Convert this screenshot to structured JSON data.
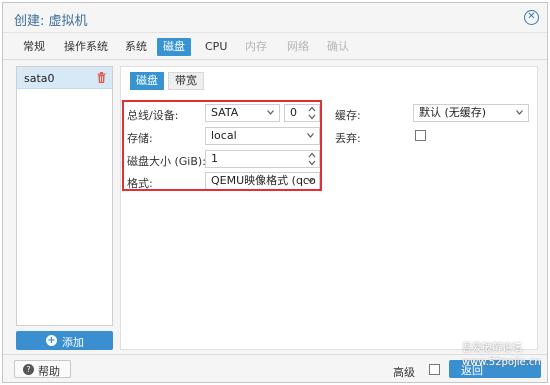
{
  "window": {
    "title": "创建: 虚拟机",
    "close_icon": "circle-x-icon"
  },
  "tabs": [
    {
      "label": "常规",
      "state": "normal"
    },
    {
      "label": "操作系统",
      "state": "normal"
    },
    {
      "label": "系统",
      "state": "normal"
    },
    {
      "label": "磁盘",
      "state": "active"
    },
    {
      "label": "CPU",
      "state": "normal"
    },
    {
      "label": "内存",
      "state": "disabled"
    },
    {
      "label": "网络",
      "state": "disabled"
    },
    {
      "label": "确认",
      "state": "disabled"
    }
  ],
  "disk_list": {
    "items": [
      {
        "label": "sata0"
      }
    ],
    "delete_icon": "trash-icon"
  },
  "add_button": {
    "label": "添加",
    "icon": "plus-circle-icon"
  },
  "subtabs": [
    {
      "label": "磁盘",
      "state": "active"
    },
    {
      "label": "带宽",
      "state": "normal"
    }
  ],
  "form": {
    "bus_device": {
      "label": "总线/设备:",
      "bus_value": "SATA",
      "device_value": "0"
    },
    "storage": {
      "label": "存储:",
      "value": "local"
    },
    "disk_size": {
      "label": "磁盘大小 (GiB):",
      "value": "1"
    },
    "format": {
      "label": "格式:",
      "value": "QEMU映像格式 (qco"
    },
    "cache": {
      "label": "缓存:",
      "value": "默认 (无缓存)"
    },
    "discard": {
      "label": "丢弃:",
      "checked": false
    }
  },
  "bottom": {
    "help_label": "帮助",
    "advanced_label": "高级",
    "advanced_checked": false,
    "next_label": "返回"
  },
  "watermark": {
    "line1": "吾爱破解论坛",
    "line2": "www.52pojie.cn"
  },
  "colors": {
    "accent": "#3894d1",
    "highlight_box": "#e03030",
    "selected_row": "#d7e8f7"
  }
}
